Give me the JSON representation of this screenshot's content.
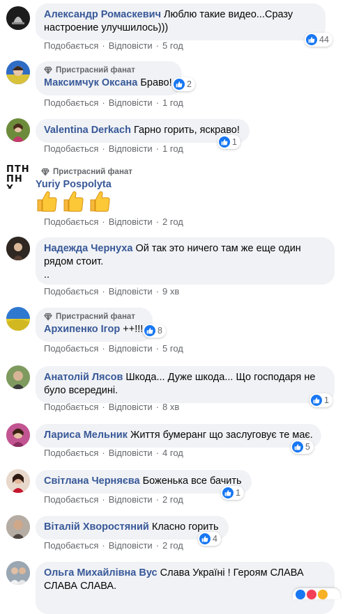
{
  "labels": {
    "like": "Подобається",
    "reply": "Відповісти",
    "fan_badge": "Пристрасний фанат"
  },
  "comments": [
    {
      "name": "Александр Ромаскевич",
      "text": "Люблю такие видео...Сразу",
      "text2": "настроение улучшилось)))",
      "time": "5 год",
      "likes": "44"
    },
    {
      "name": "Максимчук Оксана",
      "text": "Браво!",
      "time": "1 год",
      "likes": "2"
    },
    {
      "name": "Valentina Derkach",
      "text": "Гарно горить, яскраво!",
      "time": "1 год",
      "likes": "1"
    },
    {
      "name": "Yuriy Pospolyta",
      "time": "2 год",
      "avatar_text": "ПТН ПНХ"
    },
    {
      "name": "Надежда Чернуха",
      "text": "Ой так это ничего там же еще один",
      "text2": "рядом стоит.",
      "text3": "..",
      "time": "9 хв"
    },
    {
      "name": "Архипенко Ігор",
      "text": "++!!!",
      "time": "5 год",
      "likes": "8"
    },
    {
      "name": "Анатолій Лясов",
      "text": "Шкода... Дуже шкода... Що господаря не",
      "text2": "було всередині.",
      "time": "8 хв",
      "likes": "1"
    },
    {
      "name": "Лариса Мельник",
      "text": "Життя бумеранг що заслуговує те має.",
      "time": "4 год",
      "likes": "5"
    },
    {
      "name": "Світлана Черняєва",
      "text": "Боженька все бачить",
      "time": "2 год",
      "likes": "1"
    },
    {
      "name": "Віталій Хворостяний",
      "text": "Класно горить",
      "time": "2 год",
      "likes": "4"
    },
    {
      "name": "Ольга Михайлівна Вус",
      "text": "Слава Україні ! Героям СЛАВА",
      "text2": "СЛАВА СЛАВА."
    }
  ],
  "colors": {
    "name": "#385898",
    "bubble": "#f0f2f5",
    "meta": "#65676b",
    "like": "#1877f2"
  }
}
